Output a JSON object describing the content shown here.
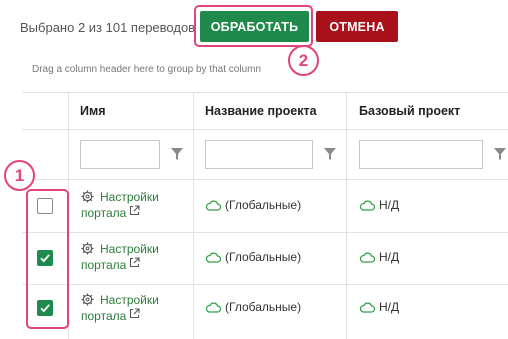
{
  "toolbar": {
    "selected_text": "Выбрано 2 из 101 переводов",
    "process_label": "ОБРАБОТАТЬ",
    "cancel_label": "ОТМЕНА"
  },
  "callouts": {
    "checkboxes": "1",
    "process": "2"
  },
  "grid": {
    "group_hint": "Drag a column header here to group by that column",
    "columns": [
      "Имя",
      "Название проекта",
      "Базовый проект"
    ],
    "rows": [
      {
        "checked": false,
        "name_line1": "Настройки",
        "name_line2": "портала",
        "project": "(Глобальные)",
        "base": "Н/Д"
      },
      {
        "checked": true,
        "name_line1": "Настройки",
        "name_line2": "портала",
        "project": "(Глобальные)",
        "base": "Н/Д"
      },
      {
        "checked": true,
        "name_line1": "Настройки",
        "name_line2": "портала",
        "project": "(Глобальные)",
        "base": "Н/Д"
      }
    ]
  },
  "colors": {
    "accent_green": "#1f8a4c",
    "cancel_red": "#a8101a",
    "callout_pink": "#e0457b",
    "link_green": "#2d7d3a"
  }
}
